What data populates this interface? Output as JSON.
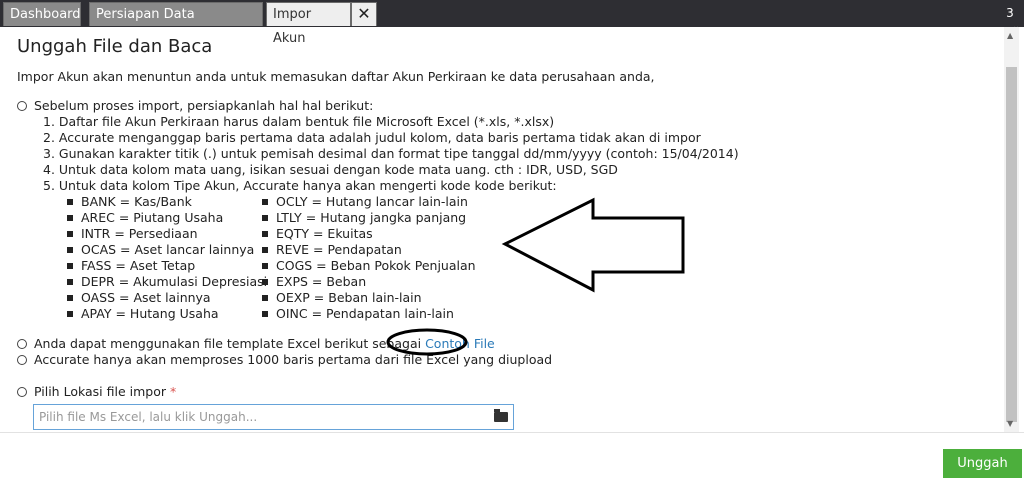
{
  "tabs": [
    {
      "label": "Dashboard",
      "active": false
    },
    {
      "label": "Persiapan Data Perusahaan",
      "active": false
    },
    {
      "label": "Impor Akun",
      "active": true
    }
  ],
  "tab_close_icon": "close-icon",
  "tab_counter": "3",
  "page": {
    "title": "Unggah File dan Baca",
    "intro": "Impor Akun akan menuntun anda untuk memasukan daftar Akun Perkiraan ke data perusahaan anda,",
    "prep_header": "Sebelum proses import, persiapkanlah hal hal berikut:",
    "steps": [
      "1. Daftar file Akun Perkiraan harus dalam bentuk file Microsoft Excel (*.xls, *.xlsx)",
      "2. Accurate menganggap baris pertama data adalah judul kolom, data baris pertama tidak akan di impor",
      "3. Gunakan karakter titik (.) untuk pemisah desimal dan format tipe tanggal dd/mm/yyyy (contoh: 15/04/2014)",
      "4. Untuk data kolom mata uang, isikan sesuai dengan kode mata uang. cth : IDR, USD, SGD",
      "5. Untuk data kolom Tipe Akun, Accurate hanya akan mengerti kode kode berikut:"
    ],
    "codes_left": [
      "BANK = Kas/Bank",
      "AREC = Piutang Usaha",
      "INTR = Persediaan",
      "OCAS = Aset lancar lainnya",
      "FASS = Aset Tetap",
      "DEPR = Akumulasi Depresiasi",
      "OASS = Aset lainnya",
      "APAY = Hutang Usaha"
    ],
    "codes_right": [
      "OCLY = Hutang lancar lain-lain",
      "LTLY = Hutang jangka panjang",
      "EQTY = Ekuitas",
      "REVE = Pendapatan",
      "COGS = Beban Pokok Penjualan",
      "EXPS = Beban",
      "OEXP = Beban lain-lain",
      "OINC = Pendapatan lain-lain"
    ],
    "template_text": "Anda dapat menggunakan file template Excel berikut sebagai",
    "template_link": "Contoh File",
    "limit_text": "Accurate hanya akan memproses 1000 baris pertama dari file Excel yang diupload",
    "file_label": "Pilih Lokasi file impor",
    "required_mark": "*",
    "file_placeholder": "Pilih file Ms Excel, lalu klik Unggah..."
  },
  "upload_button": "Unggah",
  "colors": {
    "upload": "#4caf3c",
    "link": "#2a7ab8",
    "tabbar": "#2e2e33"
  }
}
